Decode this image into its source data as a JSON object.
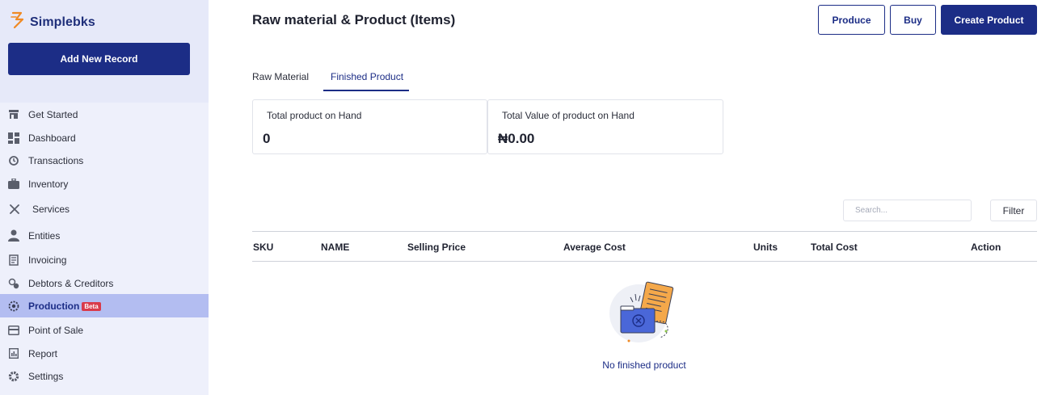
{
  "app": {
    "name": "Simplebks"
  },
  "sidebar": {
    "add_button": "Add New Record",
    "items": [
      {
        "label": "Get Started",
        "icon": "store-icon"
      },
      {
        "label": "Dashboard",
        "icon": "dashboard-icon"
      },
      {
        "label": "Transactions",
        "icon": "transactions-icon"
      },
      {
        "label": "Inventory",
        "icon": "briefcase-icon"
      },
      {
        "label": "Services",
        "icon": "tools-icon"
      },
      {
        "label": "Entities",
        "icon": "person-icon"
      },
      {
        "label": "Invoicing",
        "icon": "invoice-icon"
      },
      {
        "label": "Debtors & Creditors",
        "icon": "debtors-icon"
      },
      {
        "label": "Production",
        "icon": "production-icon",
        "badge": "Beta",
        "active": true
      },
      {
        "label": "Point of Sale",
        "icon": "card-icon"
      },
      {
        "label": "Report",
        "icon": "report-icon"
      },
      {
        "label": "Settings",
        "icon": "gear-icon"
      }
    ]
  },
  "header": {
    "title": "Raw material & Product (Items)",
    "produce_label": "Produce",
    "buy_label": "Buy",
    "create_label": "Create Product"
  },
  "tabs": [
    {
      "label": "Raw Material",
      "active": false
    },
    {
      "label": "Finished Product",
      "active": true
    }
  ],
  "stats": [
    {
      "label": "Total product on Hand",
      "value": "0"
    },
    {
      "label": "Total Value of product on Hand",
      "value": "₦0.00"
    }
  ],
  "search": {
    "placeholder": "Search..."
  },
  "filter_label": "Filter",
  "table": {
    "columns": [
      "SKU",
      "NAME",
      "Selling Price",
      "Average Cost",
      "Units",
      "Total Cost",
      "Action"
    ]
  },
  "empty_state": {
    "message": "No finished product"
  },
  "colors": {
    "brand": "#1c2d86",
    "sidebar_bg": "#eef0fb",
    "active_bg": "#b3bdf1",
    "badge": "#d93a4a",
    "logo_accent": "#f08a24"
  }
}
